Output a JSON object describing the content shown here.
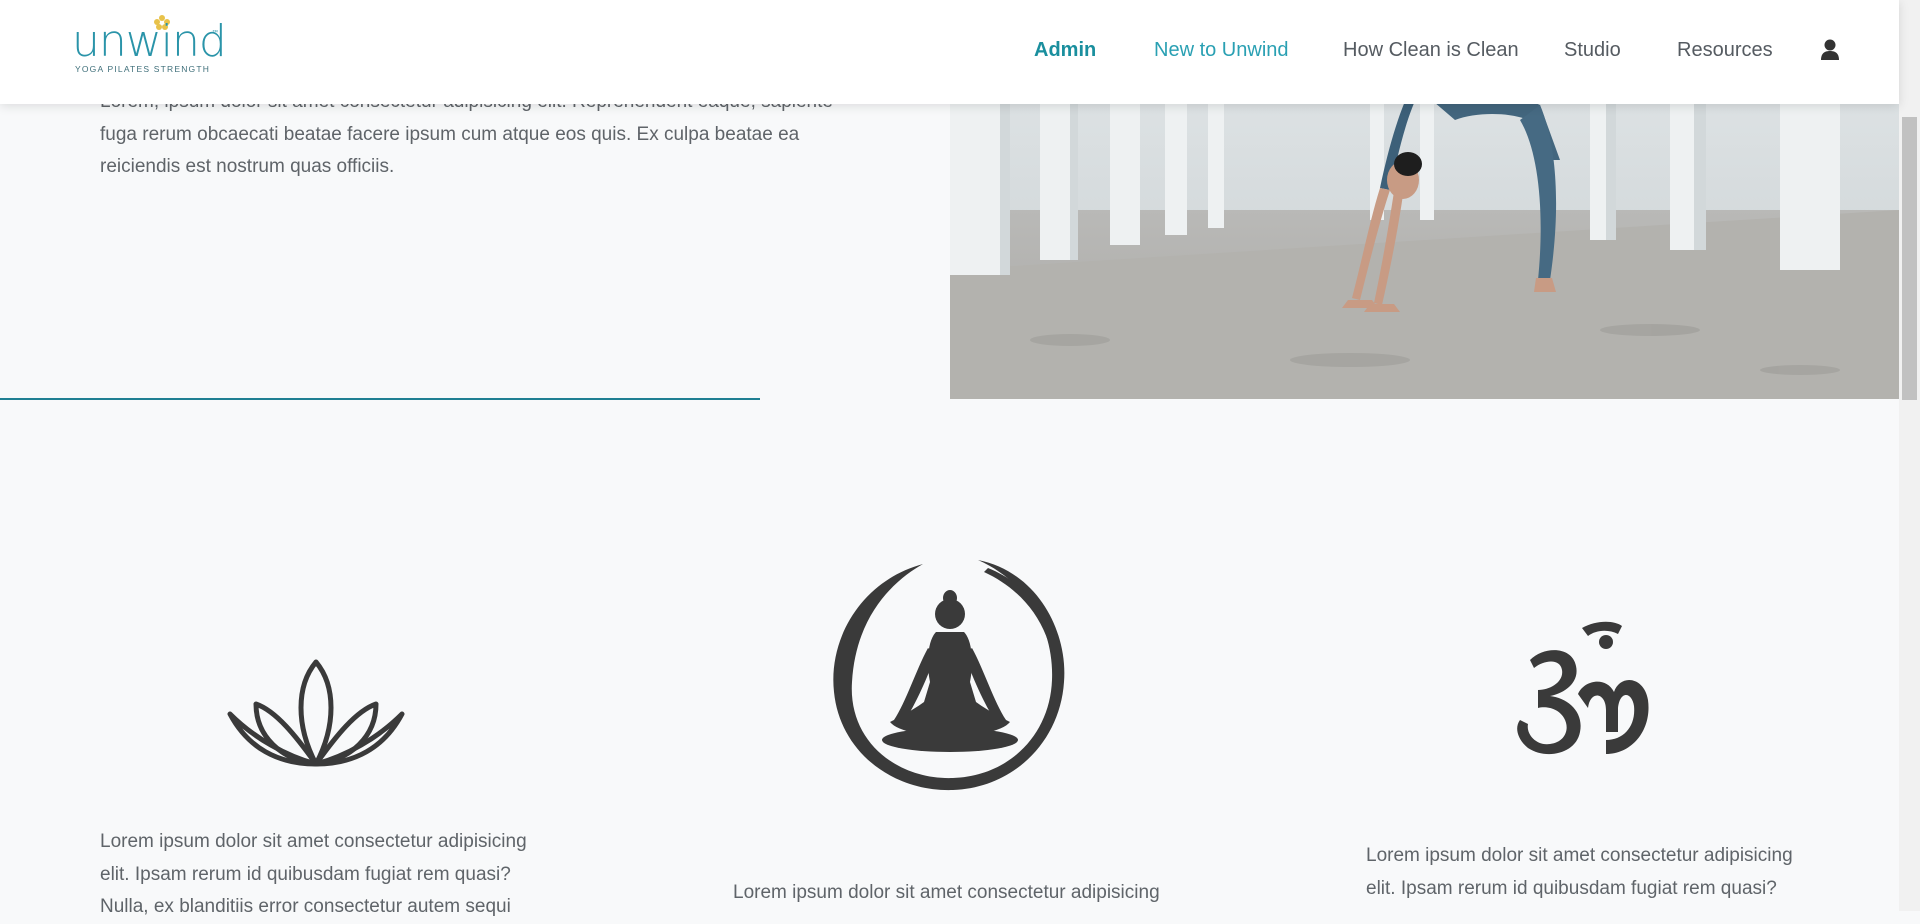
{
  "brand": {
    "name": "unwind",
    "tagline": "YOGA PILATES STRENGTH",
    "trademark": "™",
    "accent_color": "#2a94a9"
  },
  "nav": {
    "items": [
      {
        "label": "Admin",
        "active": true
      },
      {
        "label": "New to Unwind"
      },
      {
        "label": "How Clean is Clean"
      },
      {
        "label": "Studio"
      },
      {
        "label": "Resources"
      }
    ],
    "user_icon": "user-icon"
  },
  "hero": {
    "paragraph": "Lorem, ipsum dolor sit amet consectetur adipisicing elit. Reprehenderit eaque, sapiente fuga rerum obcaecati beatae facere ipsum cum atque eos quis. Ex culpa beatae ea reiciendis est nostrum quas officiis.",
    "image": "woman-in-yoga-backbend-photo"
  },
  "features": [
    {
      "icon": "lotus-icon",
      "text": "Lorem ipsum dolor sit amet consectetur adipisicing elit. Ipsam rerum id quibusdam fugiat rem quasi? Nulla, ex blanditiis error consectetur autem sequi"
    },
    {
      "icon": "meditation-icon",
      "text": "Lorem ipsum dolor sit amet consectetur adipisicing"
    },
    {
      "icon": "om-icon",
      "text": "Lorem ipsum dolor sit amet consectetur adipisicing elit. Ipsam rerum id quibusdam fugiat rem quasi?"
    }
  ],
  "colors": {
    "background": "#f8f9fa",
    "nav_active": "#1a8f9e",
    "nav_highlight": "#2aa0b3",
    "icon": "#3a3a3a",
    "rule": "#1f7f92"
  }
}
